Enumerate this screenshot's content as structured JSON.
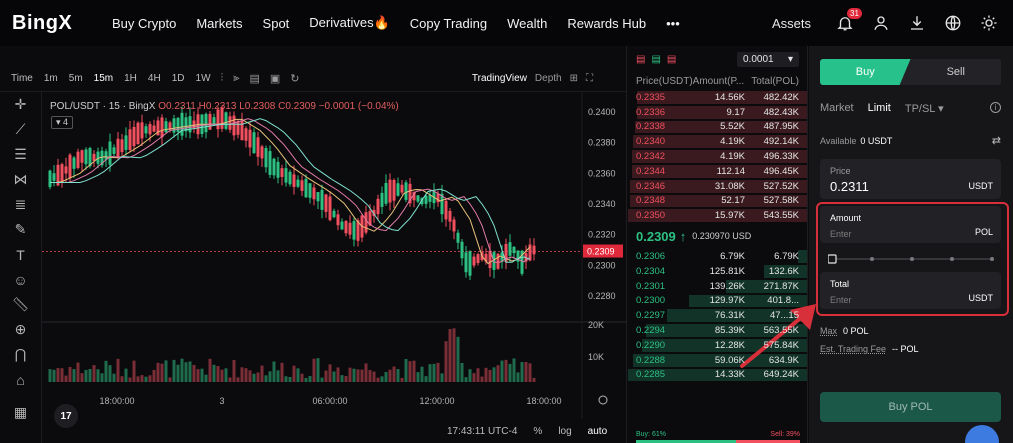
{
  "nav": {
    "logo": "BingX",
    "items": [
      "Buy Crypto",
      "Markets",
      "Spot",
      "Derivatives🔥",
      "Copy Trading",
      "Wealth",
      "Rewards Hub"
    ],
    "more": "•••",
    "assets": "Assets",
    "notif_count": "31"
  },
  "chart": {
    "timeframes": [
      "Time",
      "1m",
      "5m",
      "15m",
      "1H",
      "4H",
      "1D",
      "1W"
    ],
    "active_timeframe": "15m",
    "tradingview": "TradingView",
    "depth": "Depth",
    "pair": "POL/USDT · 15 · BingX",
    "ohlc": "O0.2311 H0.2313 L0.2308 C0.2309 −0.0001 (−0.04%)",
    "indicators_count": "4",
    "price_ticks": [
      "0.2400",
      "0.2380",
      "0.2360",
      "0.2340",
      "0.2320",
      "0.2300",
      "0.2280"
    ],
    "current_price": "0.2309",
    "vol_ticks": [
      "20K",
      "10K"
    ],
    "time_ticks": [
      "18:00:00",
      "3",
      "06:00:00",
      "12:00:00",
      "18:00:00"
    ],
    "clock": "17:43:11 UTC-4",
    "pct": "%",
    "log": "log",
    "auto": "auto",
    "tv_logo": "17"
  },
  "orderbook": {
    "precision": "0.0001",
    "headers": [
      "Price(USDT)",
      "Amount(P...",
      "Total(POL)"
    ],
    "asks": [
      {
        "p": "0.2335",
        "a": "14.56K",
        "t": "482.42K",
        "d": 0.95
      },
      {
        "p": "0.2336",
        "a": "9.17",
        "t": "482.43K",
        "d": 0.95
      },
      {
        "p": "0.2338",
        "a": "5.52K",
        "t": "487.95K",
        "d": 0.96
      },
      {
        "p": "0.2340",
        "a": "4.19K",
        "t": "492.14K",
        "d": 0.97
      },
      {
        "p": "0.2342",
        "a": "4.19K",
        "t": "496.33K",
        "d": 0.98
      },
      {
        "p": "0.2344",
        "a": "112.14",
        "t": "496.45K",
        "d": 0.98
      },
      {
        "p": "0.2346",
        "a": "31.08K",
        "t": "527.52K",
        "d": 0.99
      },
      {
        "p": "0.2348",
        "a": "52.17",
        "t": "527.58K",
        "d": 0.99
      },
      {
        "p": "0.2350",
        "a": "15.97K",
        "t": "543.55K",
        "d": 1.0
      }
    ],
    "mid_price": "0.2309",
    "mid_arrow": "↑",
    "mid_usd": "0.230970 USD",
    "bids": [
      {
        "p": "0.2306",
        "a": "6.79K",
        "t": "6.79K",
        "d": 0.05
      },
      {
        "p": "0.2304",
        "a": "125.81K",
        "t": "132.6K",
        "d": 0.24
      },
      {
        "p": "0.2301",
        "a": "139.26K",
        "t": "271.87K",
        "d": 0.45
      },
      {
        "p": "0.2300",
        "a": "129.97K",
        "t": "401.8...",
        "d": 0.66
      },
      {
        "p": "0.2297",
        "a": "76.31K",
        "t": "47...15",
        "d": 0.78
      },
      {
        "p": "0.2294",
        "a": "85.39K",
        "t": "563.55K",
        "d": 0.9
      },
      {
        "p": "0.2290",
        "a": "12.28K",
        "t": "575.84K",
        "d": 0.92
      },
      {
        "p": "0.2288",
        "a": "59.06K",
        "t": "634.9K",
        "d": 0.97
      },
      {
        "p": "0.2285",
        "a": "14.33K",
        "t": "649.24K",
        "d": 1.0
      }
    ],
    "buy_ratio": "Buy: 61%",
    "sell_ratio": "Sell: 39%",
    "buy_pct": 61
  },
  "trade": {
    "buy": "Buy",
    "sell": "Sell",
    "order_types": [
      "Market",
      "Limit",
      "TP/SL ▾"
    ],
    "active_type": "Limit",
    "available_label": "Available",
    "available_value": "0 USDT",
    "price_label": "Price",
    "price_value": "0.2311",
    "price_unit": "USDT",
    "amount_label": "Amount",
    "amount_placeholder": "Enter",
    "amount_unit": "POL",
    "total_label": "Total",
    "total_placeholder": "Enter",
    "total_unit": "USDT",
    "max_label": "Max",
    "max_value": "0 POL",
    "fee_label": "Est. Trading Fee",
    "fee_value": "-- POL",
    "buy_button": "Buy POL"
  },
  "colors": {
    "up": "#2cc083",
    "down": "#f24f5f",
    "accent": "#27c28b",
    "highlight": "#d8303a"
  }
}
